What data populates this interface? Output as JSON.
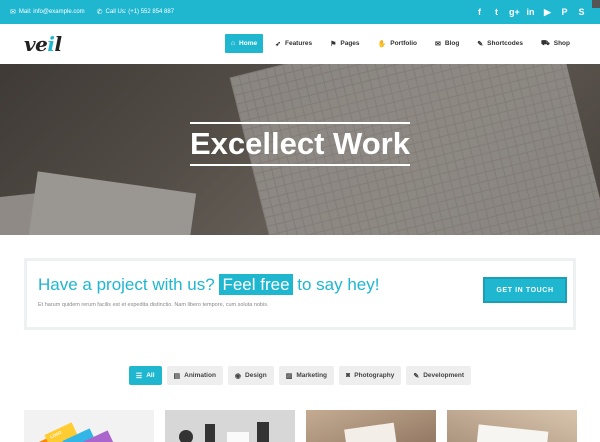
{
  "topbar": {
    "mail": "Mail: info@example.com",
    "phone": "Call Us: (+1) 552 854 887",
    "social_icons": [
      "facebook-icon",
      "twitter-icon",
      "google-plus-icon",
      "linkedin-icon",
      "youtube-icon",
      "pinterest-icon",
      "skype-icon"
    ],
    "social_glyphs": [
      "f",
      "t",
      "g+",
      "in",
      "▶",
      "P",
      "S"
    ]
  },
  "brand": {
    "logo_main": "ve",
    "logo_accent": "i",
    "logo_end": "l"
  },
  "nav": {
    "items": [
      {
        "label": "Home",
        "icon": "home-icon",
        "glyph": "⌂",
        "active": true
      },
      {
        "label": "Features",
        "icon": "rocket-icon",
        "glyph": "➶",
        "active": false
      },
      {
        "label": "Pages",
        "icon": "flag-icon",
        "glyph": "⚑",
        "active": false
      },
      {
        "label": "Portfolio",
        "icon": "thumbs-up-icon",
        "glyph": "✋",
        "active": false
      },
      {
        "label": "Blog",
        "icon": "comments-icon",
        "glyph": "✉",
        "active": false
      },
      {
        "label": "Shortcodes",
        "icon": "wrench-icon",
        "glyph": "✎",
        "active": false
      },
      {
        "label": "Shop",
        "icon": "cart-icon",
        "glyph": "⛟",
        "active": false
      }
    ]
  },
  "hero": {
    "title": "Excellect Work"
  },
  "cta": {
    "before": "Have a project with us?",
    "highlight": "Feel free",
    "after": "to say hey!",
    "subtext": "Et harum quidem rerum facilis est et expedita distinctio. Nam libero tempore, cum soluta nobis.",
    "button": "GET IN TOUCH"
  },
  "filters": [
    {
      "label": "All",
      "icon": "list-icon",
      "glyph": "☰",
      "active": true
    },
    {
      "label": "Animation",
      "icon": "film-icon",
      "glyph": "▤",
      "active": false
    },
    {
      "label": "Design",
      "icon": "eye-icon",
      "glyph": "◉",
      "active": false
    },
    {
      "label": "Marketing",
      "icon": "picture-icon",
      "glyph": "▨",
      "active": false
    },
    {
      "label": "Photography",
      "icon": "camera-icon",
      "glyph": "◙",
      "active": false
    },
    {
      "label": "Development",
      "icon": "wrench-icon",
      "glyph": "✎",
      "active": false
    }
  ],
  "thumbs": {
    "logo_text": "LOGO"
  },
  "colors": {
    "accent": "#1fb6d0",
    "dark": "#333333",
    "light_gray": "#eeeeee"
  }
}
